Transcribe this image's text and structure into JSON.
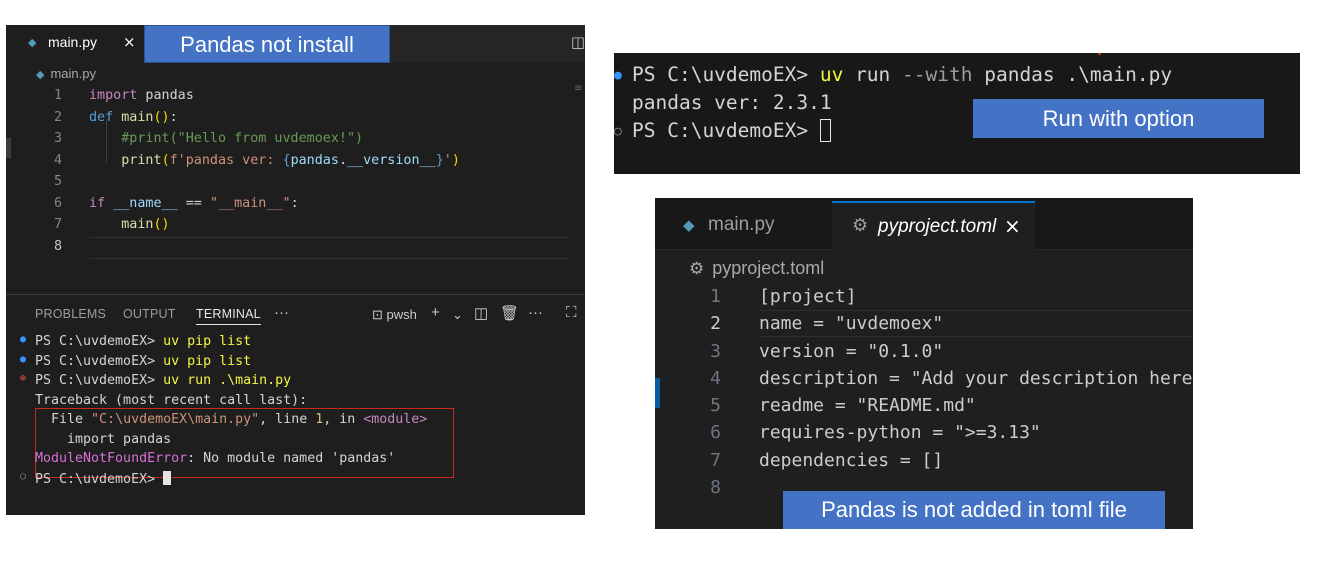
{
  "panel_a": {
    "tab": {
      "label": "main.py",
      "close": "×"
    },
    "breadcrumb": "main.py",
    "code_lines": [
      {
        "n": "1",
        "parts": [
          [
            "kw",
            "import"
          ],
          [
            "pn",
            " pandas"
          ]
        ]
      },
      {
        "n": "2",
        "parts": [
          [
            "df",
            "def"
          ],
          [
            "pn",
            " "
          ],
          [
            "fn",
            "main"
          ],
          [
            "br",
            "()"
          ],
          [
            "pn",
            ":"
          ]
        ]
      },
      {
        "n": "3",
        "parts": [
          [
            "pn",
            "    "
          ],
          [
            "cm",
            "#print(\"Hello from uvdemoex!\")"
          ]
        ]
      },
      {
        "n": "4",
        "parts": [
          [
            "pn",
            "    "
          ],
          [
            "fn",
            "print"
          ],
          [
            "br",
            "("
          ],
          [
            "str",
            "f'pandas ver: "
          ],
          [
            "df",
            "{"
          ],
          [
            "vr",
            "pandas"
          ],
          [
            "pn",
            "."
          ],
          [
            "vr",
            "__version__"
          ],
          [
            "df",
            "}"
          ],
          [
            "str",
            "'"
          ],
          [
            "br",
            ")"
          ]
        ]
      },
      {
        "n": "5",
        "parts": []
      },
      {
        "n": "6",
        "parts": [
          [
            "kw",
            "if"
          ],
          [
            "pn",
            " "
          ],
          [
            "vr",
            "__name__"
          ],
          [
            "pn",
            " == "
          ],
          [
            "str",
            "\"__main__\""
          ],
          [
            "pn",
            ":"
          ]
        ]
      },
      {
        "n": "7",
        "parts": [
          [
            "pn",
            "    "
          ],
          [
            "fn",
            "main"
          ],
          [
            "br",
            "()"
          ]
        ]
      },
      {
        "n": "8",
        "parts": [],
        "active": true
      }
    ],
    "terminal_tabs": [
      "PROBLEMS",
      "OUTPUT",
      "TERMINAL"
    ],
    "terminal_more": "···",
    "terminal_shell": "pwsh",
    "terminal_lines": [
      {
        "dot": "●",
        "dot_class": "dot-blue",
        "parts": [
          [
            "pn",
            "PS C:\\uvdemoEX> "
          ],
          [
            "cmd",
            "uv pip list"
          ]
        ]
      },
      {
        "dot": "●",
        "dot_class": "dot-blue",
        "parts": [
          [
            "pn",
            "PS C:\\uvdemoEX> "
          ],
          [
            "cmd",
            "uv pip list"
          ]
        ]
      },
      {
        "dot": "⊗",
        "dot_class": "dot-red",
        "parts": [
          [
            "pn",
            "PS C:\\uvdemoEX> "
          ],
          [
            "cmd",
            "uv run .\\main.py"
          ]
        ]
      },
      {
        "dot": "",
        "dot_class": "",
        "parts": [
          [
            "pn",
            "Traceback (most recent call last):"
          ]
        ]
      },
      {
        "dot": "",
        "dot_class": "",
        "parts": [
          [
            "pn",
            "  File "
          ],
          [
            "path",
            "\"C:\\uvdemoEX\\main.py\""
          ],
          [
            "pn",
            ", line "
          ],
          [
            "num",
            "1"
          ],
          [
            "pn",
            ", in "
          ],
          [
            "mod",
            "<module>"
          ]
        ]
      },
      {
        "dot": "",
        "dot_class": "",
        "parts": [
          [
            "pn",
            "    import pandas"
          ]
        ]
      },
      {
        "dot": "",
        "dot_class": "",
        "parts": [
          [
            "err",
            "ModuleNotFoundError"
          ],
          [
            "pn",
            ": No module named 'pandas'"
          ]
        ]
      },
      {
        "dot": "○",
        "dot_class": "dot-gray",
        "parts": [
          [
            "pn",
            "PS C:\\uvdemoEX> "
          ]
        ],
        "cursor": true
      }
    ]
  },
  "notes": {
    "pandas_not_install": "Pandas not install",
    "run_with_option": "Run with option",
    "not_added_toml": "Pandas is not added in toml file"
  },
  "panel_b": {
    "lines": [
      {
        "dot": "●",
        "parts": [
          [
            "pn",
            "PS C:\\uvdemoEX> "
          ],
          [
            "cmd",
            "uv"
          ],
          [
            "pn",
            " run "
          ],
          [
            "opt",
            "--with"
          ],
          [
            "pn",
            " pandas .\\main.py"
          ]
        ]
      },
      {
        "dot": "",
        "parts": [
          [
            "pn",
            "pandas ver: 2.3.1"
          ]
        ]
      },
      {
        "dot": "○",
        "parts": [
          [
            "pn",
            "PS C:\\uvdemoEX> "
          ]
        ],
        "cursor": true
      }
    ]
  },
  "panel_c": {
    "tab_main": "main.py",
    "tab_toml": "pyproject.toml",
    "tab_close": "×",
    "breadcrumb": "pyproject.toml",
    "code_lines": [
      {
        "n": "1",
        "text": "[project]"
      },
      {
        "n": "2",
        "text": "name = \"uvdemoex\"",
        "active": true
      },
      {
        "n": "3",
        "text": "version = \"0.1.0\""
      },
      {
        "n": "4",
        "text": "description = \"Add your description here\""
      },
      {
        "n": "5",
        "text": "readme = \"README.md\""
      },
      {
        "n": "6",
        "text": "requires-python = \">=3.13\""
      },
      {
        "n": "7",
        "text": "dependencies = []"
      },
      {
        "n": "8",
        "text": ""
      }
    ]
  }
}
